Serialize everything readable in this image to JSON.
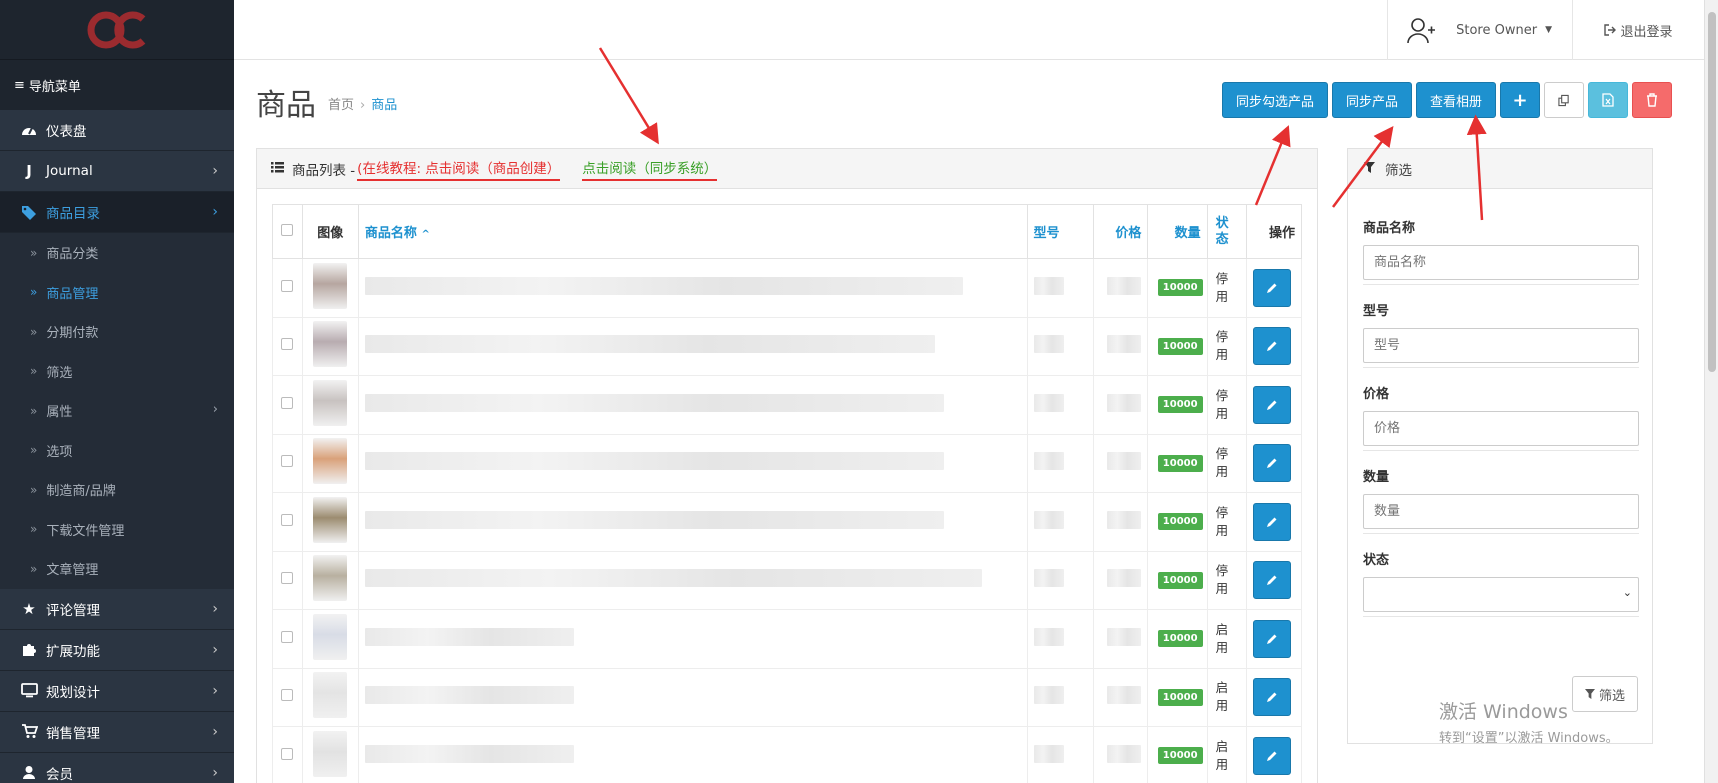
{
  "brand": {
    "logo_text": "OC"
  },
  "sidebar": {
    "header": "导航菜单",
    "items": [
      {
        "label": "仪表盘",
        "icon": "dashboard-icon"
      },
      {
        "label": "Journal",
        "icon": "journal-icon"
      },
      {
        "label": "商品目录",
        "icon": "tags-icon"
      },
      {
        "label": "评论管理",
        "icon": "star-icon"
      },
      {
        "label": "扩展功能",
        "icon": "puzzle-icon"
      },
      {
        "label": "规划设计",
        "icon": "monitor-icon"
      },
      {
        "label": "销售管理",
        "icon": "cart-icon"
      },
      {
        "label": "会员",
        "icon": "user-icon"
      }
    ],
    "subitems": [
      "商品分类",
      "商品管理",
      "分期付款",
      "筛选",
      "属性",
      "选项",
      "制造商/品牌",
      "下载文件管理",
      "文章管理"
    ]
  },
  "header": {
    "user_name": "Store Owner",
    "logout": "退出登录"
  },
  "page": {
    "title": "商品",
    "breadcrumb": {
      "home": "首页",
      "current": "商品"
    }
  },
  "toolbar": {
    "sync_selected": "同步勾选产品",
    "sync_products": "同步产品",
    "view_album": "查看相册"
  },
  "list": {
    "heading": "商品列表 -",
    "tutorial_link": "(在线教程: 点击阅读（商品创建）",
    "sync_link": "点击阅读（同步系统）",
    "columns": {
      "image": "图像",
      "name": "商品名称",
      "model": "型号",
      "price": "价格",
      "quantity": "数量",
      "status": "状态",
      "action": "操作"
    },
    "rows": [
      {
        "quantity": "10000",
        "status": "停用"
      },
      {
        "quantity": "10000",
        "status": "停用"
      },
      {
        "quantity": "10000",
        "status": "停用"
      },
      {
        "quantity": "10000",
        "status": "停用"
      },
      {
        "quantity": "10000",
        "status": "停用"
      },
      {
        "quantity": "10000",
        "status": "停用"
      },
      {
        "quantity": "10000",
        "status": "启用"
      },
      {
        "quantity": "10000",
        "status": "启用"
      },
      {
        "quantity": "10000",
        "status": "启用"
      }
    ]
  },
  "filter": {
    "title": "筛选",
    "name_label": "商品名称",
    "name_placeholder": "商品名称",
    "model_label": "型号",
    "model_placeholder": "型号",
    "price_label": "价格",
    "price_placeholder": "价格",
    "quantity_label": "数量",
    "quantity_placeholder": "数量",
    "status_label": "状态",
    "button": "筛选"
  },
  "watermark": {
    "line1": "激活 Windows",
    "line2": "转到“设置”以激活 Windows。"
  },
  "colors": {
    "primary": "#1e91cf",
    "sidebar": "#27303d",
    "success": "#4cae4c",
    "danger": "#f56b6b",
    "annotation": "#e53030"
  }
}
